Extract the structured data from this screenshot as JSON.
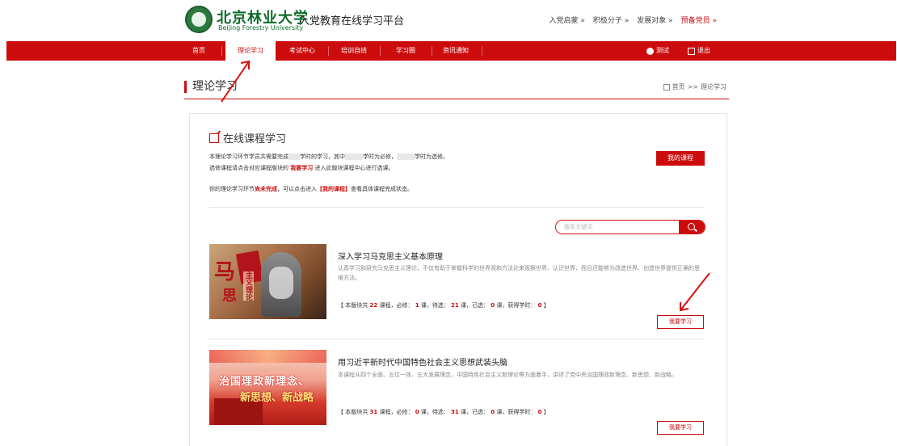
{
  "header": {
    "logo_cn": "北京林业大学",
    "logo_en": "Beijing Forestry University",
    "platform_title": "入党教育在线学习平台",
    "top_links": [
      {
        "label": "入党启蒙 »",
        "active": false
      },
      {
        "label": "积极分子 »",
        "active": false
      },
      {
        "label": "发展对象 »",
        "active": false
      },
      {
        "label": "预备党员 »",
        "active": true
      }
    ]
  },
  "nav": {
    "items": [
      "首页",
      "理论学习",
      "考试中心",
      "培训自结",
      "学习圈",
      "资讯通知"
    ],
    "active_index": 1,
    "right": {
      "user_label": "测试",
      "logout_label": "退出"
    }
  },
  "page": {
    "title": "理论学习",
    "breadcrumb": {
      "home": "首页",
      "sep": ">>",
      "current": "理论学习"
    }
  },
  "section": {
    "title": "在线课程学习",
    "intro_line1_a": "本理论学习环节学员共需要完成",
    "intro_line1_b": "学时的学习，其中",
    "intro_line1_c": "学时为必修，",
    "intro_line1_d": "学时为选修。",
    "intro_line2_a": "选修课程请点击对应课程版块的",
    "intro_line2_link": "我要学习",
    "intro_line2_b": "进入此版块课程中心进行选课。",
    "intro_line3_a": "你的理论学习环节",
    "intro_line3_status": "尚未完成",
    "intro_line3_b": "，可以点击进入",
    "intro_line3_link": "【我的课程】",
    "intro_line3_c": "查看具体课程完成状态。",
    "my_courses_button": "我的课程"
  },
  "search": {
    "placeholder": "搜索关键词"
  },
  "courses": [
    {
      "title": "深入学习马克思主义基本原理",
      "description": "认真学习和研究马克思主义理论，不仅有助于掌握科学的世界观和方法论来观察世界、认识世界，而且还能够为改造世界、创造世界提供正确的思维方法。",
      "image_text": [
        "马",
        "克",
        "思"
      ],
      "image_label": "主义理论",
      "stats": {
        "prefix": "【 本版块共",
        "total": "22",
        "total_unit": "课程，必修：",
        "required": "1",
        "required_unit": "课，待选：",
        "pending": "21",
        "pending_unit": "课，已选：",
        "selected": "0",
        "selected_unit": "课，获得学时：",
        "hours": "0",
        "suffix": "】"
      },
      "button": "我要学习"
    },
    {
      "title": "用习近平新时代中国特色社会主义思想武装头脑",
      "description": "本课程从四个全面、五位一体、五大发展理念，中国特色社会主义新理论等方面着手，讲述了党中央治国理政新理念、新思想、新战略。",
      "image_line1": "治国理政新理念、",
      "image_line2": "新思想、新战略",
      "stats": {
        "prefix": "【 本版块共",
        "total": "31",
        "total_unit": "课程，必修：",
        "required": "0",
        "required_unit": "课，待选：",
        "pending": "31",
        "pending_unit": "课，已选：",
        "selected": "0",
        "selected_unit": "课，获得学时：",
        "hours": "0",
        "suffix": "】"
      },
      "button": "我要学习"
    }
  ],
  "colors": {
    "accent": "#cc0c0c",
    "brand_green": "#0e6b2a"
  }
}
